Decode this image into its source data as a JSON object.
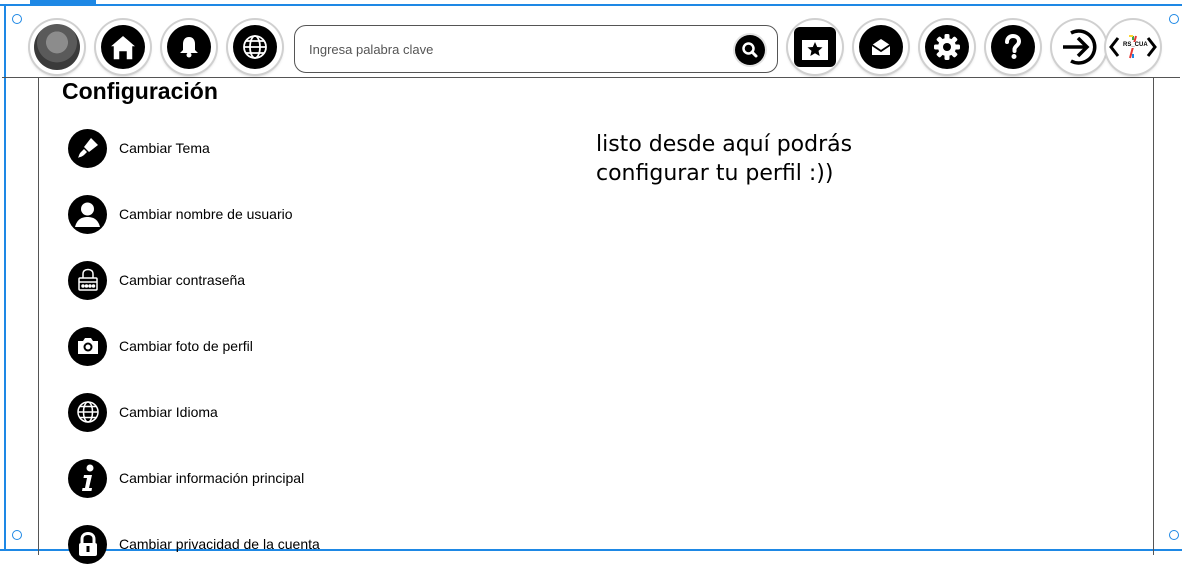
{
  "header": {
    "search": {
      "placeholder": "Ingresa palabra clave",
      "value": ""
    },
    "logo_text": "RS_CUA"
  },
  "main": {
    "title": "Configuración",
    "menu": [
      {
        "label": "Cambiar Tema",
        "icon": "paintbrush-icon"
      },
      {
        "label": "Cambiar nombre de usuario",
        "icon": "user-icon"
      },
      {
        "label": "Cambiar contraseña",
        "icon": "lock-keypad-icon"
      },
      {
        "label": "Cambiar foto de perfil",
        "icon": "camera-icon"
      },
      {
        "label": "Cambiar Idioma",
        "icon": "globe-icon"
      },
      {
        "label": "Cambiar información principal",
        "icon": "info-icon"
      },
      {
        "label": "Cambiar privacidad de la cuenta",
        "icon": "padlock-icon"
      }
    ],
    "note": "listo desde aquí podrás configurar tu perfil :))"
  },
  "colors": {
    "selection": "#1e88e5",
    "icon_fill": "#000000",
    "border": "#555555"
  }
}
